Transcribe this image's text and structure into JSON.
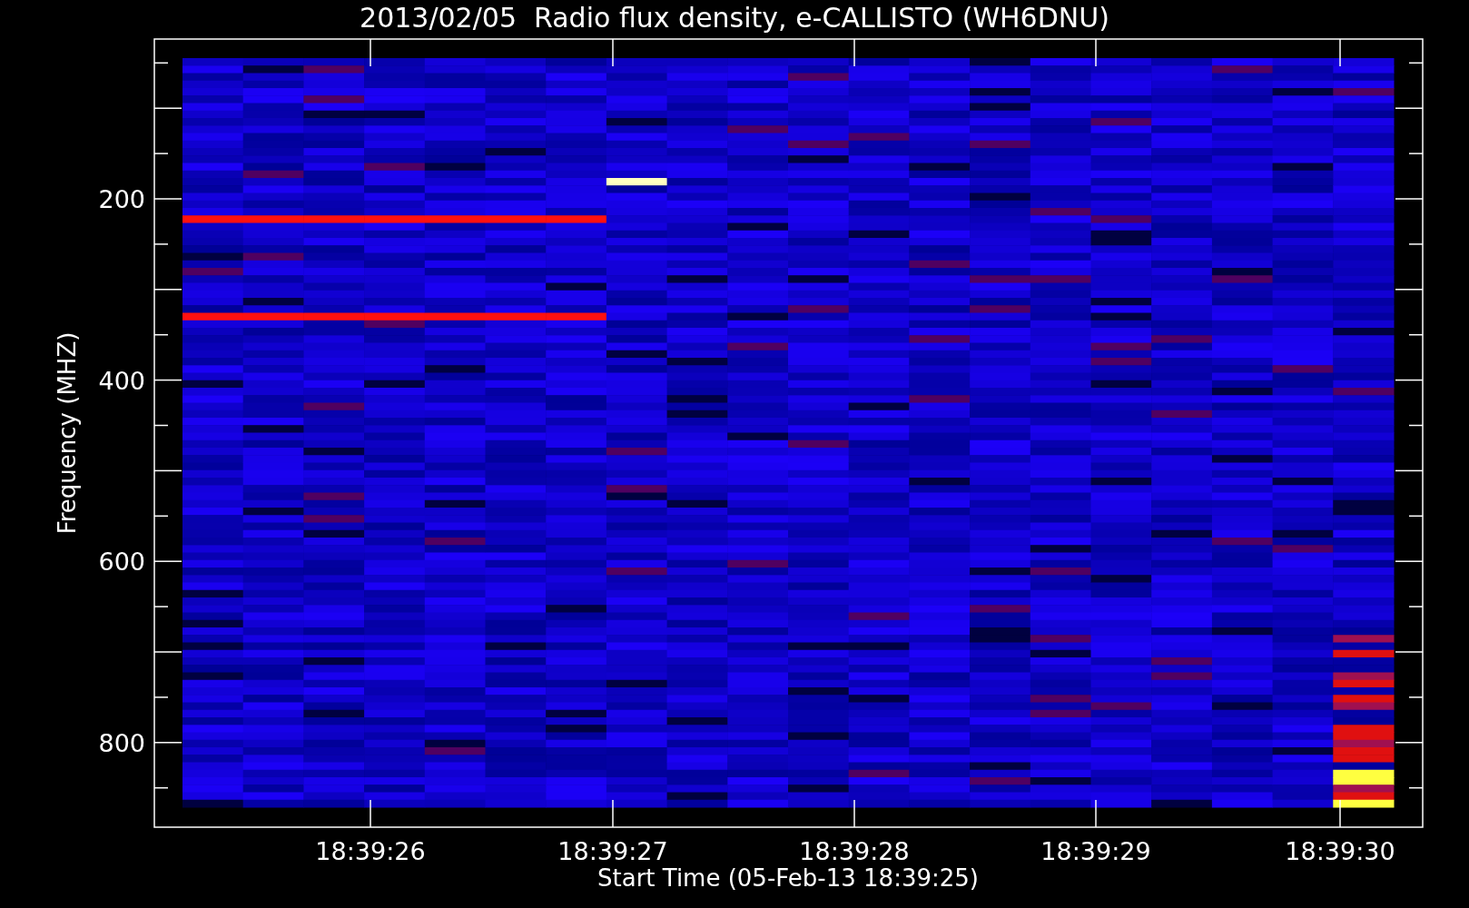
{
  "chart": {
    "title": "2013/02/05  Radio flux density, e-CALLISTO (WH6DNU)",
    "ylabel": "Frequency (MHZ)",
    "xlabel": "Start Time (05-Feb-13 18:39:25)",
    "yticks": [
      "200",
      "400",
      "600",
      "800"
    ],
    "xticks": [
      "18:39:26",
      "18:39:27",
      "18:39:28",
      "18:39:29",
      "18:39:30"
    ]
  }
}
